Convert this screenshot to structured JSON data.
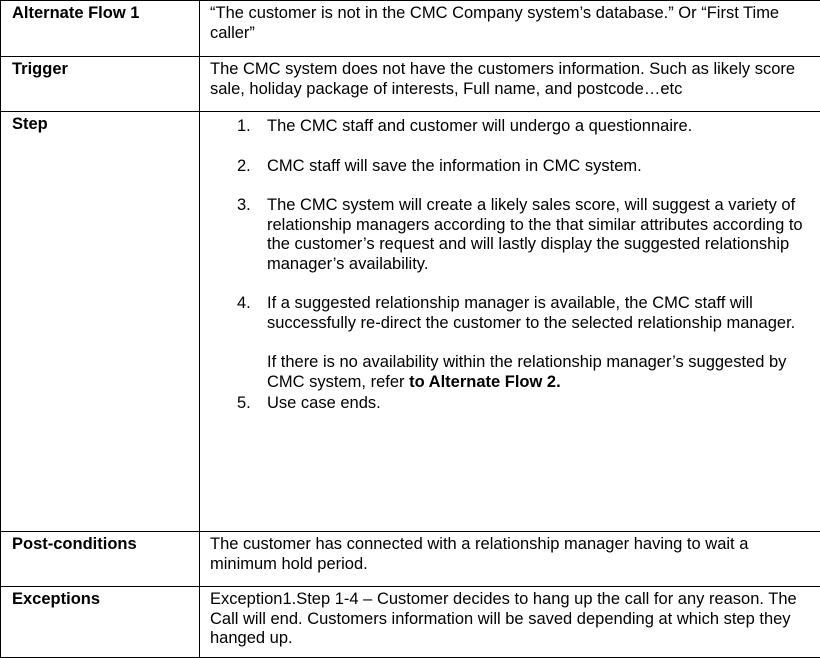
{
  "rows": {
    "alternate_flow": {
      "label": "Alternate Flow 1",
      "text": "“The customer is not in the CMC Company system’s database.”  Or “First Time caller”"
    },
    "trigger": {
      "label": "Trigger",
      "text": "The CMC system does not have the customers information. Such as likely score sale, holiday package of interests, Full name, and postcode…etc"
    },
    "step": {
      "label": "Step",
      "items": [
        {
          "num": "1.",
          "text": "The CMC staff and customer will undergo a questionnaire."
        },
        {
          "num": "2.",
          "text": "CMC staff will save the information in CMC system."
        },
        {
          "num": "3.",
          "text": "The CMC system will create a likely sales score, will suggest a variety of relationship managers according to the that similar attributes according to the customer’s request and will lastly display the suggested relationship manager’s availability."
        },
        {
          "num": "4.",
          "text": "If a suggested relationship manager is available, the CMC staff will successfully re-direct the customer to the selected relationship manager."
        },
        {
          "num": "5.",
          "text": "Use case ends."
        }
      ],
      "sub_paragraph": {
        "text": "If there is no availability within the relationship manager’s suggested by CMC system, refer ",
        "link_text": "to Alternate Flow 2."
      }
    },
    "post_conditions": {
      "label": "Post-conditions",
      "text": "The customer has connected with a relationship manager having to wait a minimum hold period."
    },
    "exceptions": {
      "label": "Exceptions",
      "text": "Exception1.Step 1-4 – Customer decides to hang up the call for any reason. The Call will end. Customers information will be saved depending at which step they hanged up."
    }
  }
}
